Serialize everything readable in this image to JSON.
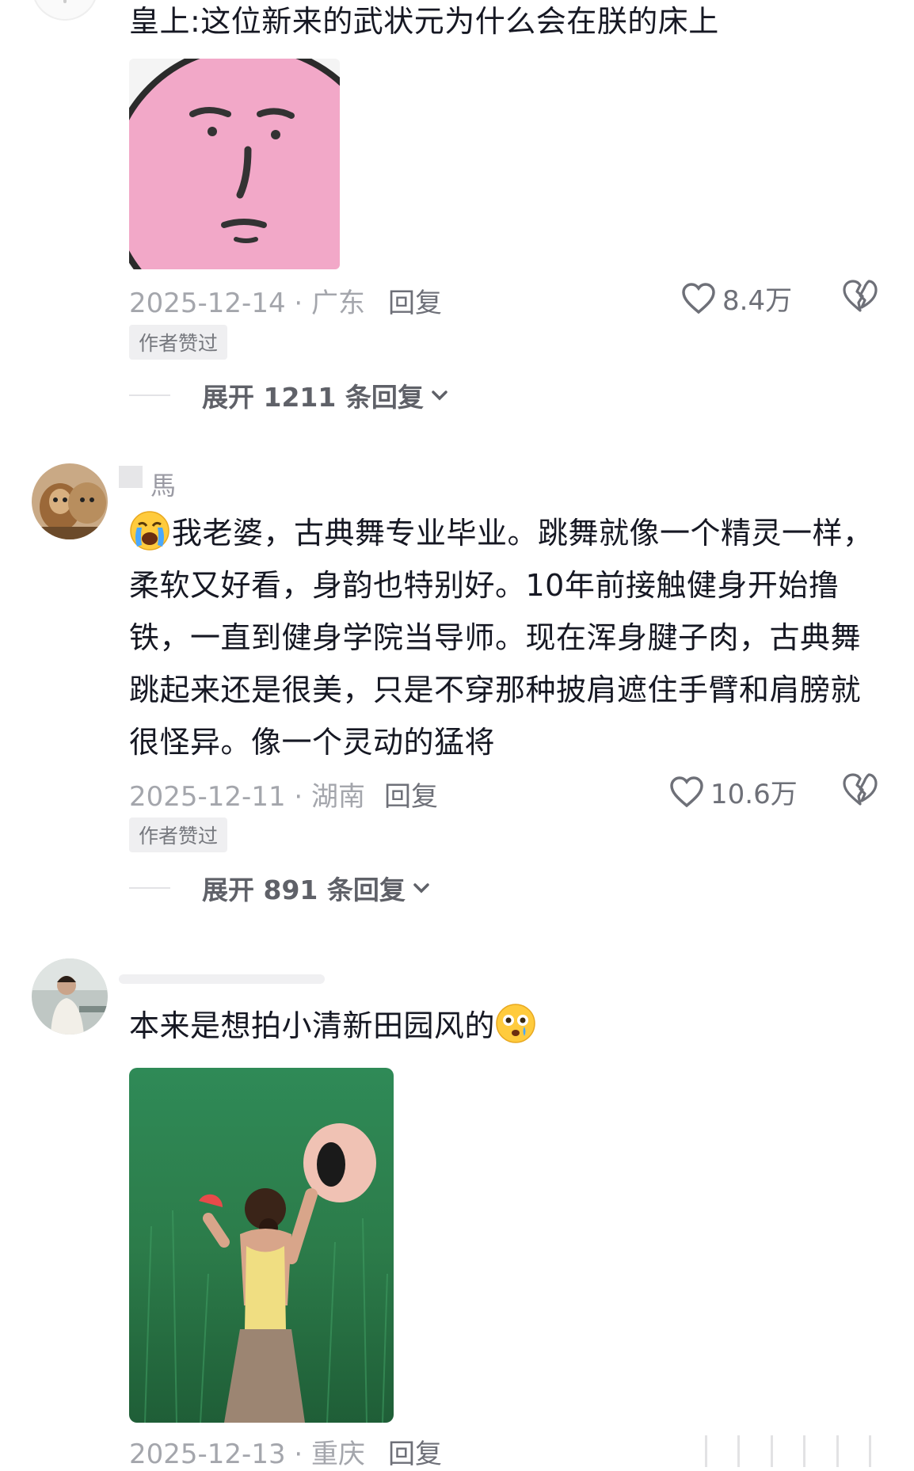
{
  "comments": [
    {
      "text": "皇上:这位新来的武状元为什么会在朕的床上",
      "date": "2025-12-14",
      "location": "· 广东",
      "reply": "回复",
      "likes": "8.4万",
      "badge": "作者赞过",
      "expand": "展开 1211 条回复"
    },
    {
      "username": "馬",
      "text": "我老婆，古典舞专业毕业。跳舞就像一个精灵一样，柔软又好看，身韵也特别好。10年前接触健身开始撸铁，一直到健身学院当导师。现在浑身腱子肉，古典舞跳起来还是很美，只是不穿那种披肩遮住手臂和肩膀就很怪异。像一个灵动的猛将",
      "date": "2025-12-11",
      "location": "· 湖南",
      "reply": "回复",
      "likes": "10.6万",
      "badge": "作者赞过",
      "expand": "展开 891 条回复"
    },
    {
      "text": "本来是想拍小清新田园风的",
      "date": "2025-12-13",
      "location": "· 重庆",
      "reply": "回复"
    }
  ],
  "colors": {
    "text": "#161823",
    "meta": "#a4a6ac",
    "badge_bg": "#efeff1"
  },
  "icons": [
    "heart-icon",
    "broken-heart-icon",
    "chevron-down-icon",
    "loud-crying-emoji",
    "flushed-emoji"
  ]
}
